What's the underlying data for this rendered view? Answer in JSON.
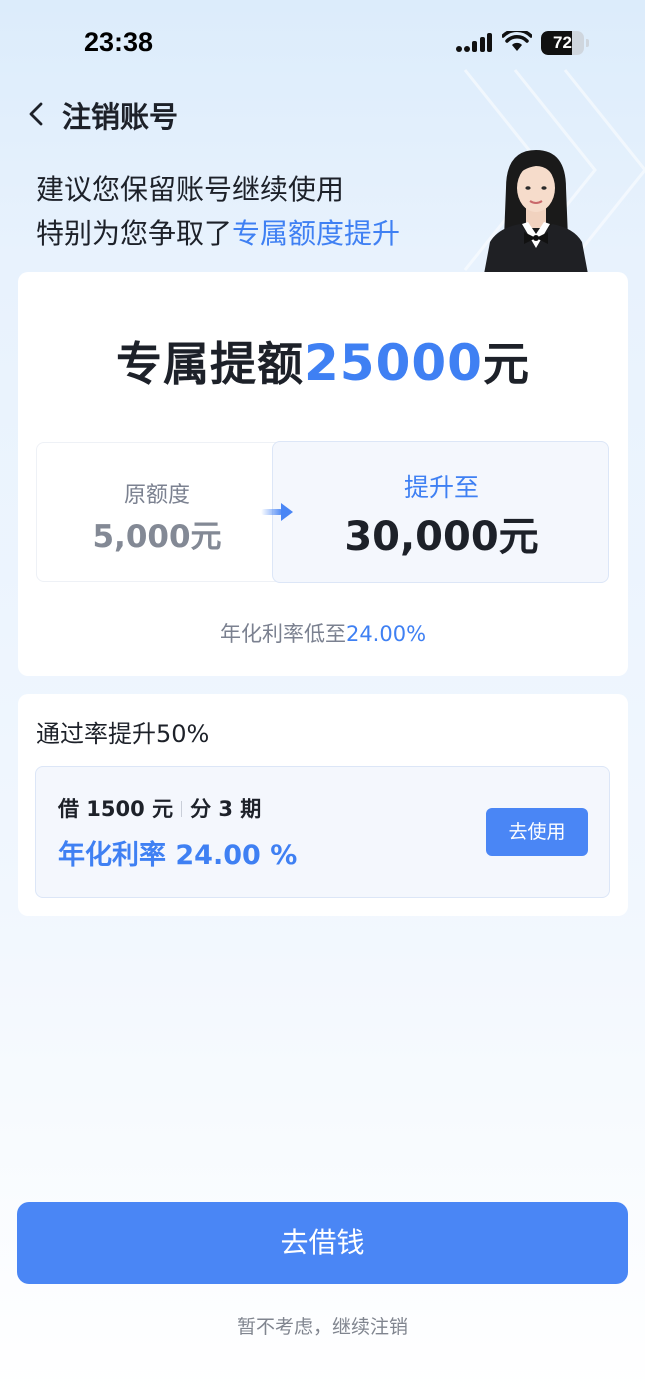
{
  "status_bar": {
    "time": "23:38",
    "battery": "72",
    "battery_level": 0.72
  },
  "nav": {
    "title": "注销账号",
    "back_icon": "chevron-left-icon"
  },
  "headline": {
    "line1": "建议您保留账号继续使用",
    "line2_prefix": "特别为您争取了",
    "line2_highlight": "专属额度提升"
  },
  "promo": {
    "title_prefix": "专属提额",
    "title_amount": "25000",
    "title_suffix": "元",
    "original_label": "原额度",
    "original_value": "5,000元",
    "new_label": "提升至",
    "new_value": "30,000元",
    "rate_prefix": "年化利率低至",
    "rate_value": "24.00%"
  },
  "offer": {
    "title": "通过率提升50%",
    "loan_amount": "借 1500 元",
    "loan_term": "分 3 期",
    "rate": "年化利率 24.00 %",
    "use_button": "去使用"
  },
  "actions": {
    "borrow_button": "去借钱",
    "decline_link": "暂不考虑，继续注销"
  },
  "colors": {
    "accent": "#4a86f5",
    "highlight_text": "#3f80f3",
    "dark_text": "#1d2129"
  }
}
